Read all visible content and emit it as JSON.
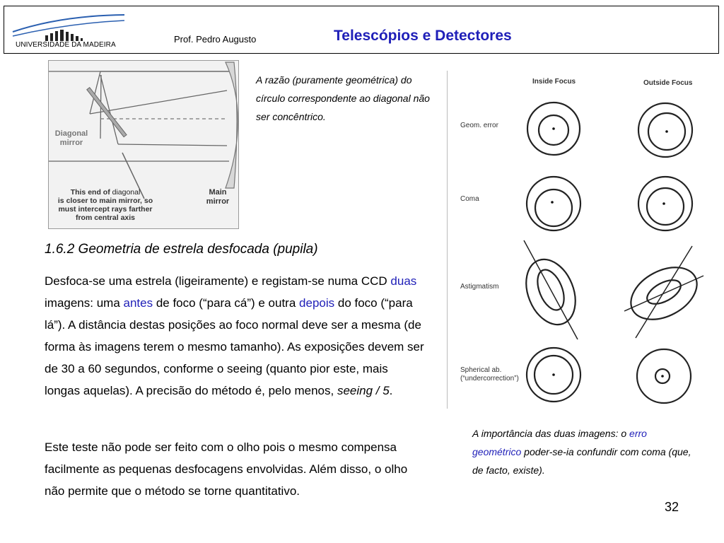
{
  "header": {
    "university": "UNIVERSIDADE DA MADEIRA",
    "author": "Prof. Pedro Augusto",
    "title": "Telescópios e Detectores"
  },
  "mirror_figure": {
    "label_diagonal": "Diagonal mirror",
    "label_main": "Main mirror",
    "label_end_a": "This end of",
    "label_end_inline": "diagonal",
    "label_end_b": "is closer to main mirror, so must intercept rays farther from central axis"
  },
  "caption_top": "A razão (puramente geométrica) do círculo correspondente ao diagonal não ser concêntrico.",
  "section_heading": "1.6.2 Geometria de estrela desfocada (pupila)",
  "paragraph1": {
    "t1": "Desfoca-se uma estrela (ligeiramente) e registam-se numa CCD ",
    "duas": "duas",
    "t2": " imagens: uma ",
    "antes": "antes",
    "t3": " de foco (“para cá”) e outra ",
    "depois": "depois",
    "t4": " do foco (“para lá”). A distância destas posições ao foco normal deve ser a mesma (de forma às imagens terem o mesmo tamanho). As exposições devem ser de 30 a 60 segundos, conforme o seeing (quanto pior este, mais longas aquelas). A precisão do método é, pelo menos, ",
    "seeing": "seeing / 5",
    "t5": "."
  },
  "paragraph2": "Este teste não pode ser feito com o olho pois o mesmo compensa facilmente as pequenas desfocagens envolvidas. Além disso, o olho não permite que o método se torne quantitativo.",
  "aberration_figure": {
    "col_inside": "Inside Focus",
    "col_outside": "Outside Focus",
    "rows": [
      "Geom. error",
      "Coma",
      "Astigmatism",
      "Spherical ab. (“undercorrection”)"
    ]
  },
  "caption_bottom": {
    "t1": "A importância das duas imagens: o ",
    "erro": "erro geométrico",
    "t2": " poder-se-ia confundir com coma (que, de facto, existe)."
  },
  "page_number": "32",
  "colors": {
    "accent_blue": "#1f1fb8"
  }
}
